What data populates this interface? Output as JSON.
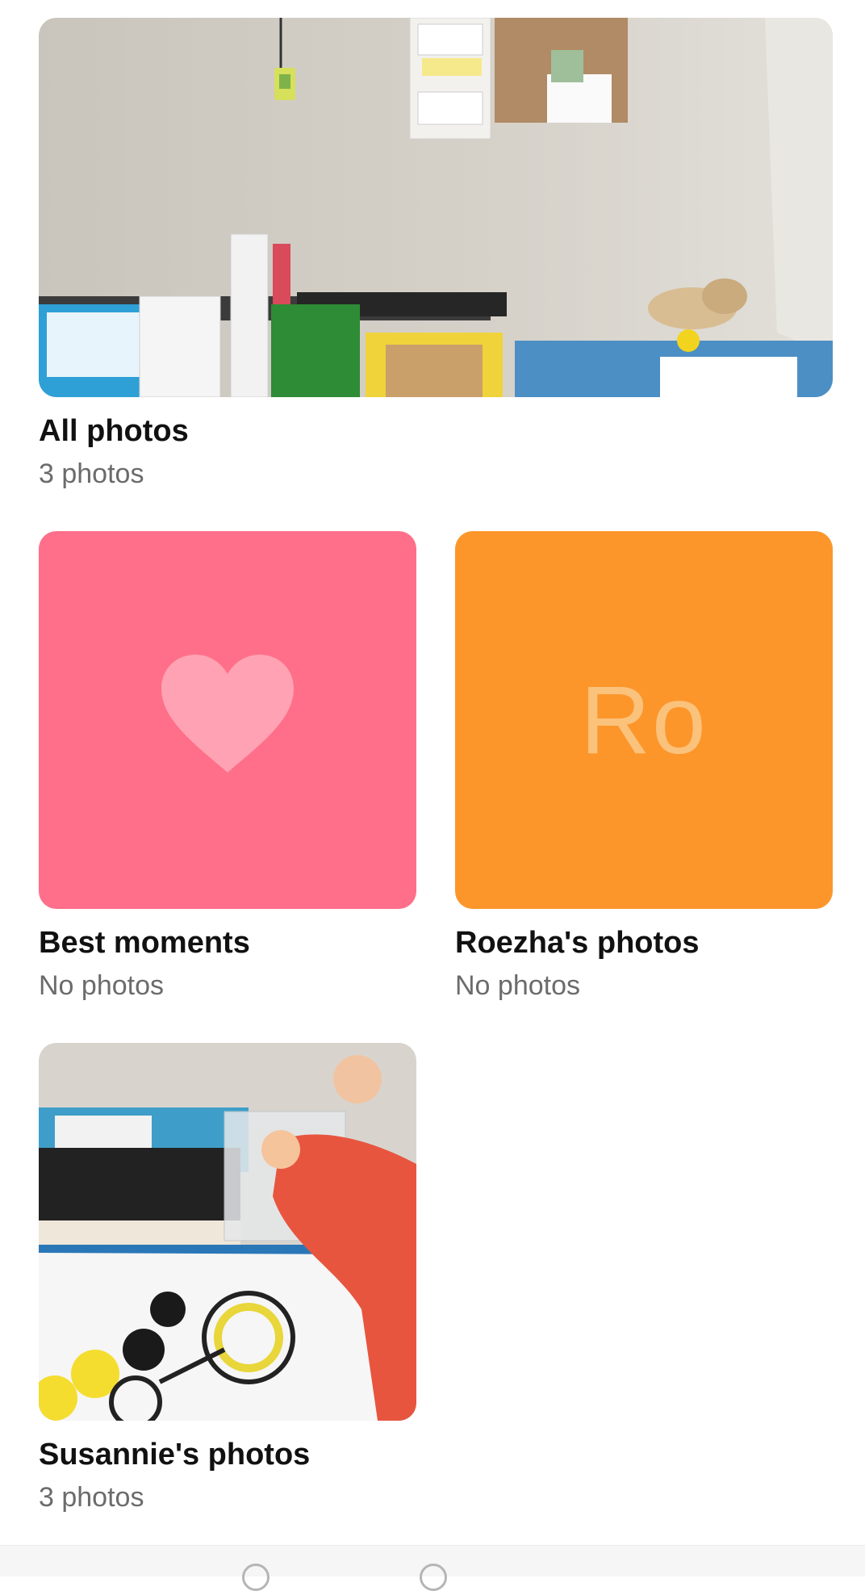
{
  "albums": [
    {
      "title": "All photos",
      "count": "3 photos",
      "thumbnail": "photo-playroom-corner"
    },
    {
      "title": "Best moments",
      "count": "No photos",
      "thumbnail_color": "#ff6f89",
      "icon": "heart-icon",
      "icon_color": "#ffa3b4"
    },
    {
      "title": "Roezha's photos",
      "count": "No photos",
      "thumbnail_color": "#fc962b",
      "monogram": "Ro"
    },
    {
      "title": "Susannie's photos",
      "count": "3 photos",
      "thumbnail": "photo-craft-activity"
    }
  ],
  "colors": {
    "title_text": "#111111",
    "count_text": "#6b6b6b",
    "background": "#ffffff"
  }
}
